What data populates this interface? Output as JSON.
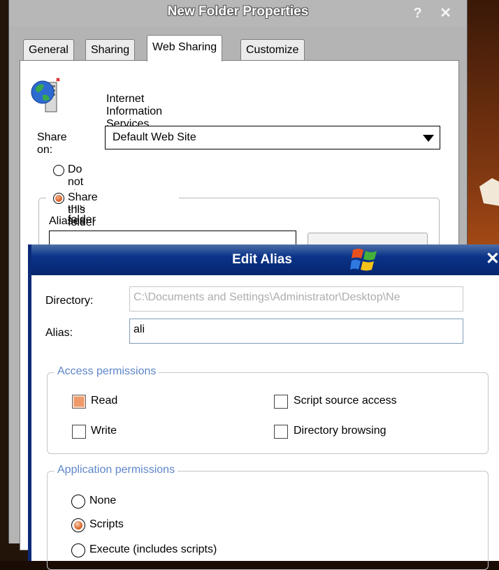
{
  "properties_window": {
    "title": "New Folder Properties",
    "title_buttons": "? ✕",
    "tabs": [
      "General",
      "Sharing",
      "Web Sharing",
      "Customize"
    ],
    "active_tab": "Web Sharing",
    "service_name": "Internet Information Services",
    "share_on_label": "Share on:",
    "share_on_value": "Default Web Site",
    "radio_do_not_share": "Do not share this folder",
    "radio_share": "Share this folder",
    "selected_share_option": "Share this folder",
    "aliases_label": "Aliases"
  },
  "edit_alias_dialog": {
    "title": "Edit Alias",
    "close_symbol": "✕",
    "directory_label": "Directory:",
    "directory_value": "C:\\Documents and Settings\\Administrator\\Desktop\\Ne",
    "alias_label": "Alias:",
    "alias_value": "ali",
    "access_permissions": {
      "title": "Access permissions",
      "read": "Read",
      "write": "Write",
      "script_source_access": "Script source access",
      "directory_browsing": "Directory browsing",
      "checked": [
        "Read"
      ]
    },
    "application_permissions": {
      "title": "Application permissions",
      "none": "None",
      "scripts": "Scripts",
      "execute": "Execute (includes scripts)",
      "selected": "Scripts"
    }
  },
  "colors": {
    "dialog_title_bar": "#0a3388",
    "group_title_text": "#5e86c9",
    "checked_accent": "#ef9a6a"
  }
}
